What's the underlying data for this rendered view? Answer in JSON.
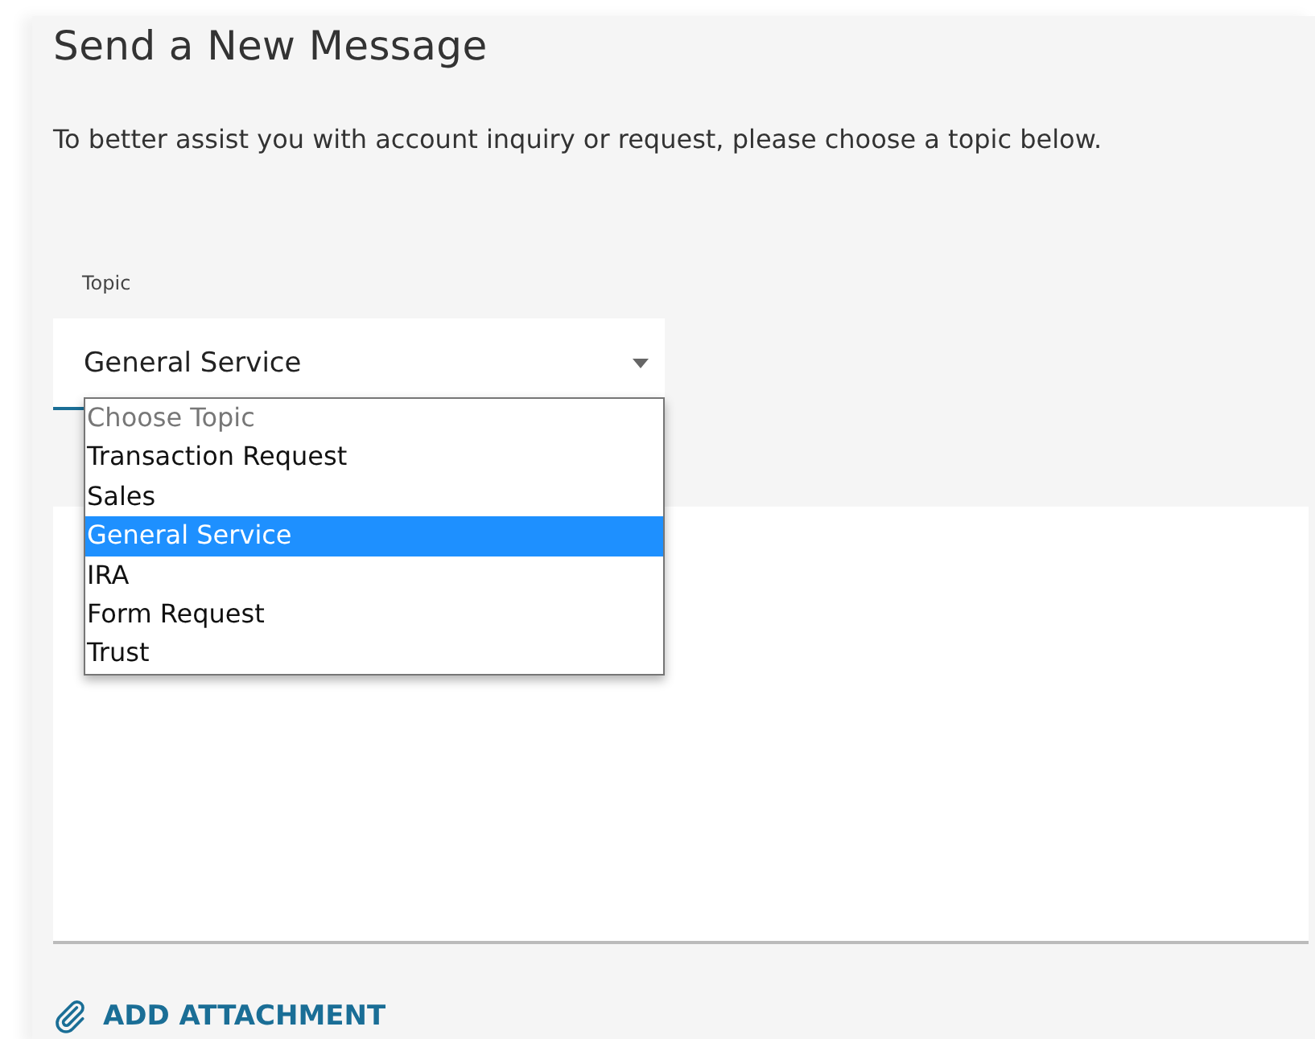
{
  "title": "Send a New Message",
  "intro": "To better assist you with account inquiry or request, please choose a topic below.",
  "topic": {
    "label": "Topic",
    "value": "General Service",
    "expanded": true,
    "options": [
      {
        "label": "Choose Topic",
        "disabled": true,
        "selected": false
      },
      {
        "label": "Transaction Request",
        "disabled": false,
        "selected": false
      },
      {
        "label": "Sales",
        "disabled": false,
        "selected": false
      },
      {
        "label": "General Service",
        "disabled": false,
        "selected": true
      },
      {
        "label": "IRA",
        "disabled": false,
        "selected": false
      },
      {
        "label": "Form Request",
        "disabled": false,
        "selected": false
      },
      {
        "label": "Trust",
        "disabled": false,
        "selected": false
      }
    ]
  },
  "attachment_link": "ADD ATTACHMENT"
}
